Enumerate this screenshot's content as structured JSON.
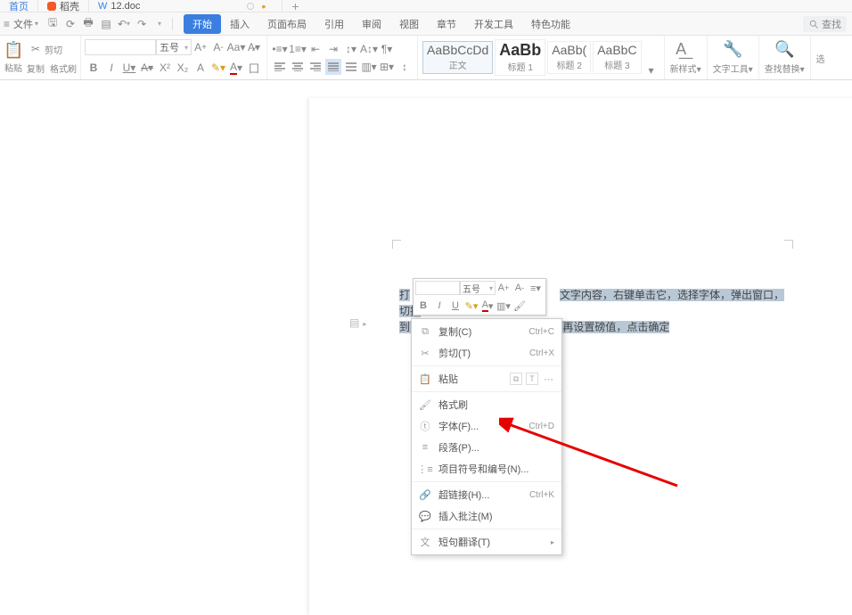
{
  "tabs": {
    "home": "首页",
    "dao": "稻壳",
    "doc": "12.doc"
  },
  "quick": {
    "file_menu": "文件"
  },
  "menu": {
    "start": "开始",
    "insert": "插入",
    "page_layout": "页面布局",
    "references": "引用",
    "review": "审阅",
    "view": "视图",
    "chapter": "章节",
    "dev": "开发工具",
    "special": "特色功能",
    "search": "查找"
  },
  "ribbon": {
    "paste": "粘贴",
    "cut": "剪切",
    "copy": "复制",
    "format_paint": "格式刷",
    "font_size": "五号",
    "styles": {
      "body_preview": "AaBbCcDd",
      "body_label": "正文",
      "h1_preview": "AaBb",
      "h1_label": "标题 1",
      "h2_preview": "AaBb(",
      "h2_label": "标题 2",
      "h3_preview": "AaBbC",
      "h3_label": "标题 3"
    },
    "new_style": "新样式",
    "text_tools": "文字工具",
    "find_replace": "查找替换",
    "select": "选"
  },
  "mini": {
    "font_size": "五号"
  },
  "contextmenu": {
    "copy": "复制(C)",
    "copy_sc": "Ctrl+C",
    "cut": "剪切(T)",
    "cut_sc": "Ctrl+X",
    "paste": "粘贴",
    "format_paint": "格式刷",
    "font": "字体(F)...",
    "font_sc": "Ctrl+D",
    "paragraph": "段落(P)...",
    "bullets": "项目符号和编号(N)...",
    "hyperlink": "超链接(H)...",
    "hyperlink_sc": "Ctrl+K",
    "comment": "插入批注(M)",
    "translate": "短句翻译(T)"
  },
  "doc_text": {
    "line1_a": "打",
    "line1_b": "文字内容，右键单击它，选择字体，弹出窗口，切换",
    "line2": "到高                                  需求选择标准，加宽或缩紧，再设置磅值，点击确定"
  }
}
